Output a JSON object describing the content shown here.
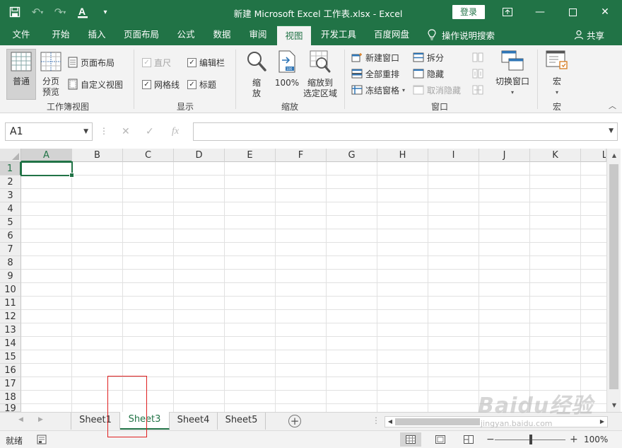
{
  "window": {
    "title": "新建 Microsoft Excel 工作表.xlsx  -  Excel",
    "login_label": "登录"
  },
  "colors": {
    "brand": "#217346",
    "ribbon_bg": "#f3f3f3",
    "annotation": "#e02020"
  },
  "tabs": [
    {
      "label": "文件"
    },
    {
      "label": "开始"
    },
    {
      "label": "插入"
    },
    {
      "label": "页面布局"
    },
    {
      "label": "公式"
    },
    {
      "label": "数据"
    },
    {
      "label": "审阅"
    },
    {
      "label": "视图",
      "active": true
    },
    {
      "label": "开发工具"
    },
    {
      "label": "百度网盘"
    }
  ],
  "tell_me": "操作说明搜索",
  "share_label": "共享",
  "ribbon": {
    "workbook_views": {
      "group_label": "工作簿视图",
      "normal": "普通",
      "page_break_1": "分页",
      "page_break_2": "预览",
      "page_layout": "页面布局",
      "custom_views": "自定义视图"
    },
    "show": {
      "group_label": "显示",
      "ruler": "直尺",
      "formula_bar": "编辑栏",
      "gridlines": "网格线",
      "headings": "标题"
    },
    "zoom": {
      "group_label": "缩放",
      "zoom_1": "缩",
      "zoom_2": "放",
      "zoom100": "100%",
      "zoom_sel_1": "缩放到",
      "zoom_sel_2": "选定区域"
    },
    "window": {
      "group_label": "窗口",
      "new_window": "新建窗口",
      "arrange_all": "全部重排",
      "freeze_panes": "冻结窗格",
      "split": "拆分",
      "hide": "隐藏",
      "unhide": "取消隐藏",
      "switch_windows": "切换窗口"
    },
    "macros": {
      "group_label": "宏",
      "macros": "宏"
    }
  },
  "formula_bar": {
    "name_box": "A1",
    "fx": "fx"
  },
  "grid": {
    "columns": [
      "A",
      "B",
      "C",
      "D",
      "E",
      "F",
      "G",
      "H",
      "I",
      "J",
      "K",
      "L"
    ],
    "rows": [
      "1",
      "2",
      "3",
      "4",
      "5",
      "6",
      "7",
      "8",
      "9",
      "10",
      "11",
      "12",
      "13",
      "14",
      "15",
      "16",
      "17",
      "18",
      "19"
    ],
    "active_column": "A",
    "active_row": "1"
  },
  "sheets": [
    {
      "label": "Sheet1"
    },
    {
      "label": "Sheet3",
      "active": true
    },
    {
      "label": "Sheet4"
    },
    {
      "label": "Sheet5"
    }
  ],
  "status": {
    "ready": "就绪",
    "zoom": "100%"
  },
  "watermark": {
    "main": "Baidu经验",
    "sub": "jingyan.baidu.com"
  }
}
